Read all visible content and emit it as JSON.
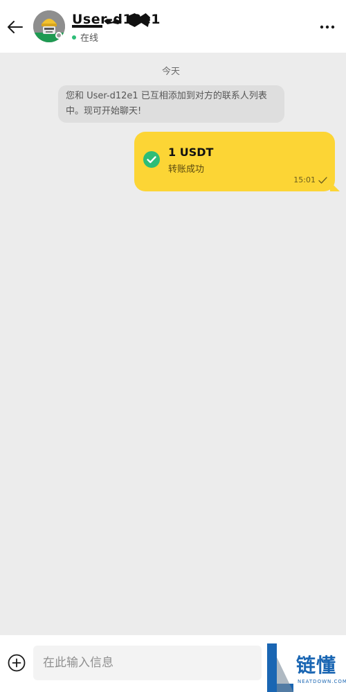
{
  "header": {
    "contact_name": "User-d12e1",
    "status": "在线",
    "status_color": "#2dbd77"
  },
  "chat": {
    "date_label": "今天",
    "system_message": "您和 User-d12e1 已互相添加到对方的联系人列表中。现可开始聊天!",
    "messages": [
      {
        "type": "transfer",
        "amount": "1 USDT",
        "status": "转账成功",
        "time": "15:01",
        "bubble_color": "#fcd535",
        "status_icon": "check-circle-icon",
        "read_icon": "checkmark-icon"
      }
    ]
  },
  "input": {
    "placeholder": "在此输入信息"
  },
  "watermark": {
    "title": "链懂",
    "subtitle": "NEATDOWN.COM",
    "color": "#1a66b3"
  },
  "icons": {
    "back": "arrow-left-icon",
    "more": "more-horizontal-icon",
    "add": "plus-circle-icon"
  }
}
